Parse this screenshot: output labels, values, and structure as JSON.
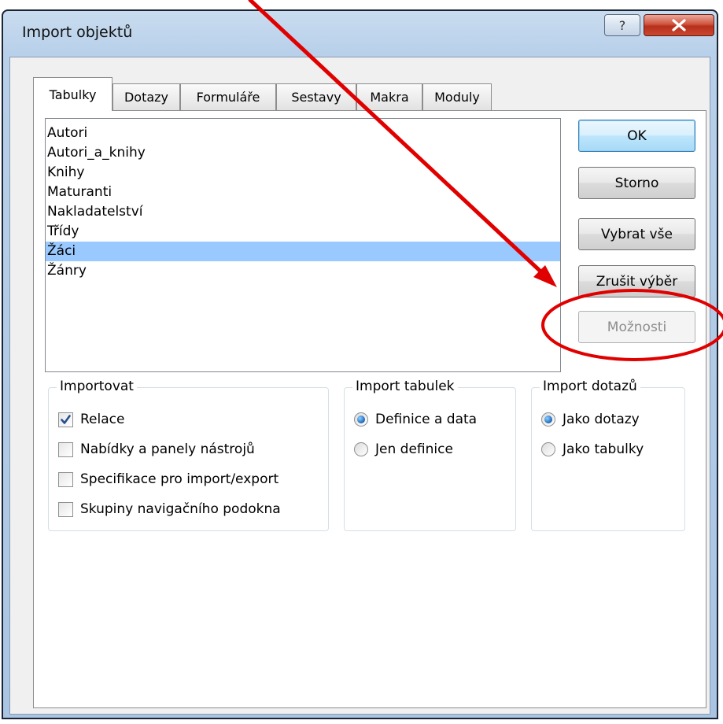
{
  "window": {
    "title": "Import objektů",
    "help_glyph": "?",
    "close_glyph": "x"
  },
  "tabs": [
    {
      "label": "Tabulky",
      "active": true
    },
    {
      "label": "Dotazy"
    },
    {
      "label": "Formuláře"
    },
    {
      "label": "Sestavy"
    },
    {
      "label": "Makra"
    },
    {
      "label": "Moduly"
    }
  ],
  "tables": {
    "items": [
      "Autori",
      "Autori_a_knihy",
      "Knihy",
      "Maturanti",
      "Nakladatelství",
      "Třídy",
      "Žáci",
      "Žánry"
    ],
    "selected": "Žáci"
  },
  "buttons": {
    "ok": "OK",
    "cancel": "Storno",
    "select_all": "Vybrat vše",
    "deselect": "Zrušit výběr",
    "options": "Možnosti"
  },
  "import_group": {
    "title": "Importovat",
    "options": [
      {
        "label": "Relace",
        "checked": true
      },
      {
        "label": "Nabídky a panely nástrojů",
        "checked": false
      },
      {
        "label": "Specifikace pro import/export",
        "checked": false
      },
      {
        "label": "Skupiny navigačního podokna",
        "checked": false
      }
    ]
  },
  "import_tables_group": {
    "title": "Import tabulek",
    "options": [
      {
        "label": "Definice a data",
        "selected": true
      },
      {
        "label": "Jen definice",
        "selected": false
      }
    ]
  },
  "import_queries_group": {
    "title": "Import dotazů",
    "options": [
      {
        "label": "Jako dotazy",
        "selected": true
      },
      {
        "label": "Jako tabulky",
        "selected": false
      }
    ]
  },
  "colors": {
    "selection": "#99c9ff",
    "annotation": "#e00000"
  }
}
